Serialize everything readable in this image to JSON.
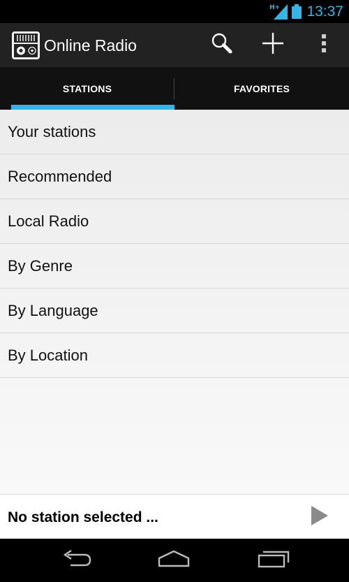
{
  "status_bar": {
    "network_type": "H+",
    "time": "13:37"
  },
  "action_bar": {
    "title": "Online Radio",
    "icons": [
      "radio-app-icon",
      "search-icon",
      "add-icon",
      "overflow-menu-icon"
    ]
  },
  "tabs": [
    {
      "label": "STATIONS",
      "selected": true
    },
    {
      "label": "FAVORITES",
      "selected": false
    }
  ],
  "menu": [
    {
      "label": "Your stations"
    },
    {
      "label": "Recommended"
    },
    {
      "label": "Local Radio"
    },
    {
      "label": "By Genre"
    },
    {
      "label": "By Language"
    },
    {
      "label": "By Location"
    }
  ],
  "player": {
    "status_text": "No station selected ..."
  },
  "nav_bar": {
    "icons": [
      "back-icon",
      "home-icon",
      "recents-icon"
    ]
  },
  "colors": {
    "accent": "#33b5e5",
    "action_bar": "#222222",
    "tab_bar": "#111111"
  }
}
